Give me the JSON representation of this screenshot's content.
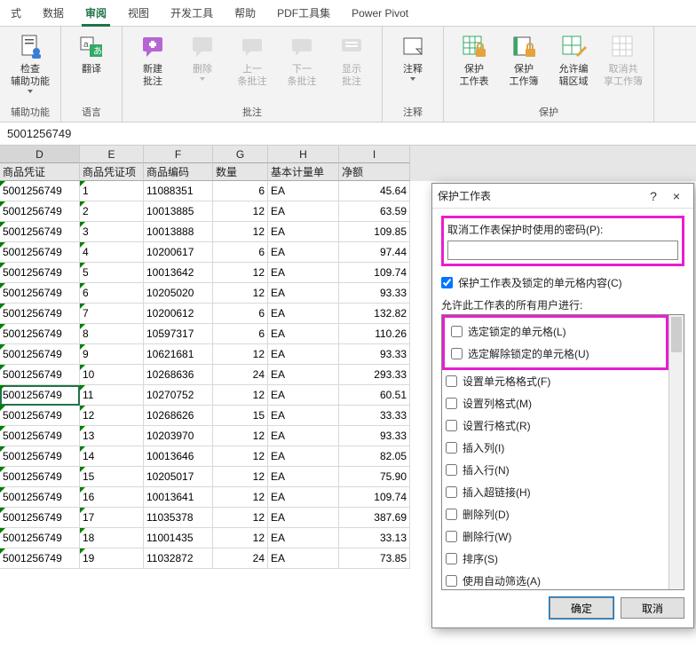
{
  "tabs": {
    "items": [
      "式",
      "数据",
      "审阅",
      "视图",
      "开发工具",
      "帮助",
      "PDF工具集",
      "Power Pivot"
    ],
    "active_index": 2
  },
  "ribbon": {
    "groups": [
      {
        "label": "辅助功能",
        "buttons": [
          {
            "name": "check-accessibility",
            "label": "检查\n辅助功能",
            "disabled": false,
            "dropdown": true,
            "icon": "doc-person"
          }
        ]
      },
      {
        "label": "语言",
        "buttons": [
          {
            "name": "translate",
            "label": "翻译",
            "disabled": false,
            "dropdown": false,
            "icon": "translate"
          }
        ]
      },
      {
        "label": "批注",
        "buttons": [
          {
            "name": "new-comment",
            "label": "新建\n批注",
            "disabled": false,
            "dropdown": false,
            "icon": "bubble-plus"
          },
          {
            "name": "delete-comment",
            "label": "删除",
            "disabled": true,
            "dropdown": true,
            "icon": "bubble-x"
          },
          {
            "name": "prev-comment",
            "label": "上一\n条批注",
            "disabled": true,
            "dropdown": false,
            "icon": "bubble-up"
          },
          {
            "name": "next-comment",
            "label": "下一\n条批注",
            "disabled": true,
            "dropdown": false,
            "icon": "bubble-down"
          },
          {
            "name": "show-comments",
            "label": "显示\n批注",
            "disabled": true,
            "dropdown": false,
            "icon": "bubble-list"
          }
        ]
      },
      {
        "label": "注释",
        "buttons": [
          {
            "name": "notes",
            "label": "注释",
            "disabled": false,
            "dropdown": true,
            "icon": "note"
          }
        ]
      },
      {
        "label": "保护",
        "buttons": [
          {
            "name": "protect-sheet",
            "label": "保护\n工作表",
            "disabled": false,
            "dropdown": false,
            "icon": "grid-lock"
          },
          {
            "name": "protect-workbook",
            "label": "保护\n工作簿",
            "disabled": false,
            "dropdown": false,
            "icon": "book-lock"
          },
          {
            "name": "allow-edit-ranges",
            "label": "允许编\n辑区域",
            "disabled": false,
            "dropdown": false,
            "icon": "grid-pencil"
          },
          {
            "name": "unshare-workbook",
            "label": "取消共\n享工作簿",
            "disabled": true,
            "dropdown": false,
            "icon": "grid"
          }
        ]
      }
    ]
  },
  "formula_bar": {
    "value": "5001256749"
  },
  "columns": [
    {
      "letter": "D",
      "label": "商品凭证",
      "w": "cD"
    },
    {
      "letter": "E",
      "label": "商品凭证项",
      "w": "cE"
    },
    {
      "letter": "F",
      "label": "商品编码",
      "w": "cF"
    },
    {
      "letter": "G",
      "label": "数量",
      "w": "cG"
    },
    {
      "letter": "H",
      "label": "基本计量单",
      "w": "cH"
    },
    {
      "letter": "I",
      "label": "净额",
      "w": "cI"
    }
  ],
  "rows": [
    {
      "d": "5001256749",
      "e": "1",
      "f": "11088351",
      "g": "6",
      "h": "EA",
      "i": "45.64"
    },
    {
      "d": "5001256749",
      "e": "2",
      "f": "10013885",
      "g": "12",
      "h": "EA",
      "i": "63.59"
    },
    {
      "d": "5001256749",
      "e": "3",
      "f": "10013888",
      "g": "12",
      "h": "EA",
      "i": "109.85"
    },
    {
      "d": "5001256749",
      "e": "4",
      "f": "10200617",
      "g": "6",
      "h": "EA",
      "i": "97.44"
    },
    {
      "d": "5001256749",
      "e": "5",
      "f": "10013642",
      "g": "12",
      "h": "EA",
      "i": "109.74"
    },
    {
      "d": "5001256749",
      "e": "6",
      "f": "10205020",
      "g": "12",
      "h": "EA",
      "i": "93.33"
    },
    {
      "d": "5001256749",
      "e": "7",
      "f": "10200612",
      "g": "6",
      "h": "EA",
      "i": "132.82"
    },
    {
      "d": "5001256749",
      "e": "8",
      "f": "10597317",
      "g": "6",
      "h": "EA",
      "i": "110.26"
    },
    {
      "d": "5001256749",
      "e": "9",
      "f": "10621681",
      "g": "12",
      "h": "EA",
      "i": "93.33"
    },
    {
      "d": "5001256749",
      "e": "10",
      "f": "10268636",
      "g": "24",
      "h": "EA",
      "i": "293.33"
    },
    {
      "d": "5001256749",
      "e": "11",
      "f": "10270752",
      "g": "12",
      "h": "EA",
      "i": "60.51"
    },
    {
      "d": "5001256749",
      "e": "12",
      "f": "10268626",
      "g": "15",
      "h": "EA",
      "i": "33.33"
    },
    {
      "d": "5001256749",
      "e": "13",
      "f": "10203970",
      "g": "12",
      "h": "EA",
      "i": "93.33"
    },
    {
      "d": "5001256749",
      "e": "14",
      "f": "10013646",
      "g": "12",
      "h": "EA",
      "i": "82.05"
    },
    {
      "d": "5001256749",
      "e": "15",
      "f": "10205017",
      "g": "12",
      "h": "EA",
      "i": "75.90"
    },
    {
      "d": "5001256749",
      "e": "16",
      "f": "10013641",
      "g": "12",
      "h": "EA",
      "i": "109.74"
    },
    {
      "d": "5001256749",
      "e": "17",
      "f": "11035378",
      "g": "12",
      "h": "EA",
      "i": "387.69"
    },
    {
      "d": "5001256749",
      "e": "18",
      "f": "11001435",
      "g": "12",
      "h": "EA",
      "i": "33.13"
    },
    {
      "d": "5001256749",
      "e": "19",
      "f": "11032872",
      "g": "24",
      "h": "EA",
      "i": "73.85"
    }
  ],
  "selected_row_index": 10,
  "dialog": {
    "title": "保护工作表",
    "help": "?",
    "close": "×",
    "password_label": "取消工作表保护时使用的密码(P):",
    "password_value": "",
    "protect_locked_label": "保护工作表及锁定的单元格内容(C)",
    "protect_locked_checked": true,
    "allow_label": "允许此工作表的所有用户进行:",
    "permissions": [
      {
        "label": "选定锁定的单元格(L)",
        "checked": false,
        "highlighted": true
      },
      {
        "label": "选定解除锁定的单元格(U)",
        "checked": false,
        "highlighted": true
      },
      {
        "label": "设置单元格格式(F)",
        "checked": false
      },
      {
        "label": "设置列格式(M)",
        "checked": false
      },
      {
        "label": "设置行格式(R)",
        "checked": false
      },
      {
        "label": "插入列(I)",
        "checked": false
      },
      {
        "label": "插入行(N)",
        "checked": false
      },
      {
        "label": "插入超链接(H)",
        "checked": false
      },
      {
        "label": "删除列(D)",
        "checked": false
      },
      {
        "label": "删除行(W)",
        "checked": false
      },
      {
        "label": "排序(S)",
        "checked": false
      },
      {
        "label": "使用自动筛选(A)",
        "checked": false
      }
    ],
    "ok": "确定",
    "cancel": "取消"
  }
}
